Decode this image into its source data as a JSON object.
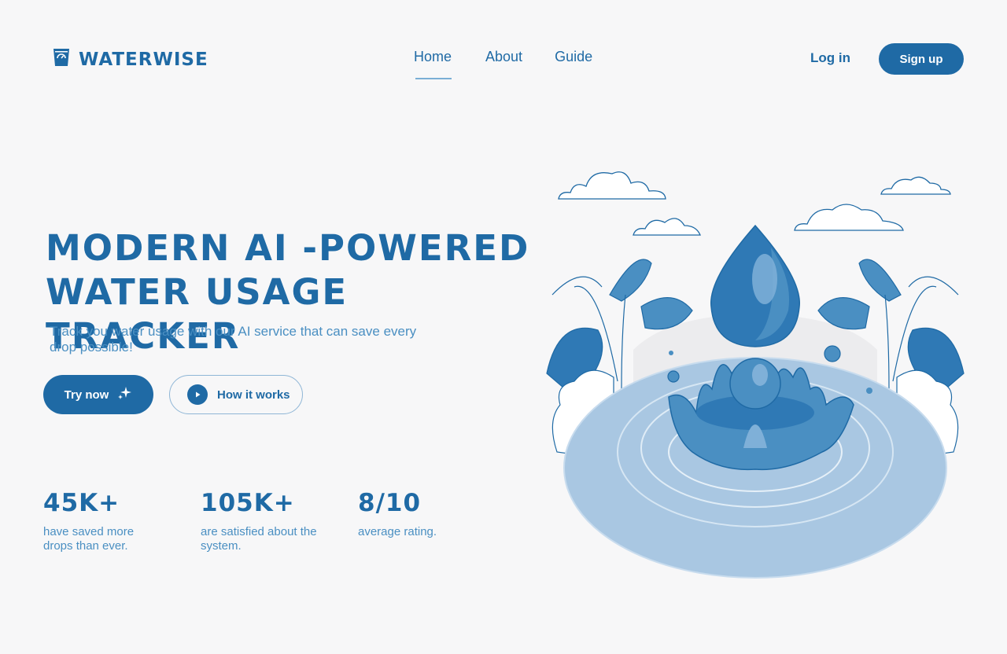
{
  "brand": {
    "name": "WATERWISE",
    "icon": "water-glass-icon"
  },
  "nav": {
    "home": "Home",
    "about": "About",
    "guide": "Guide",
    "active": "Home"
  },
  "auth": {
    "login": "Log in",
    "signup": "Sign up"
  },
  "hero": {
    "title_line1": "MODERN AI -POWERED",
    "title_line2": "WATER USAGE TRACKER",
    "subtitle": "Track you water usage with our AI service that can save every drop possible!",
    "try_label": "Try now",
    "how_label": "How it works"
  },
  "stats": [
    {
      "value": "45K+",
      "desc": "have saved more drops than ever."
    },
    {
      "value": "105K+",
      "desc": "are satisfied about the system."
    },
    {
      "value": "8/10",
      "desc": "average rating."
    }
  ],
  "colors": {
    "primary": "#1f6aa5",
    "secondary": "#4a8fc2",
    "background": "#f7f7f8",
    "water_light": "#a9c7e2"
  }
}
